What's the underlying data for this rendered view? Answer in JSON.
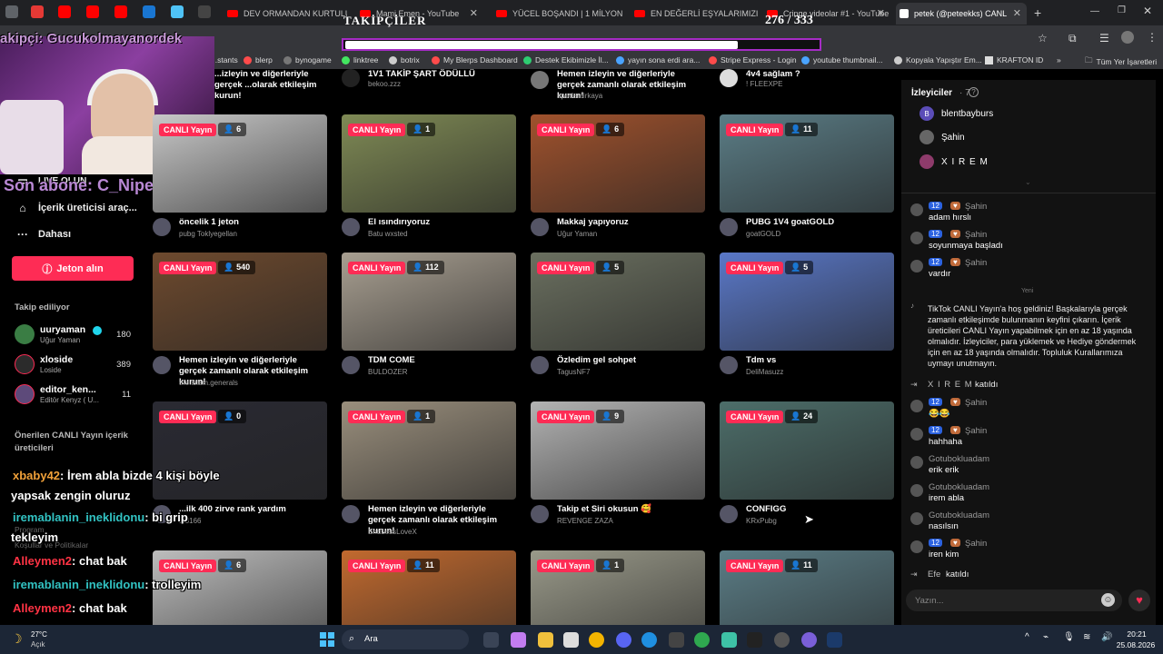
{
  "browser": {
    "tabs": [
      {
        "label": "DEV ORMANDAN KURTULUŞ"
      },
      {
        "label": "Mami Emen - YouTube"
      },
      {
        "label": "YÜCEL BOŞANDI | 1 MİLYON"
      },
      {
        "label": "EN DEĞERLİ EŞYALARIMIZI K"
      },
      {
        "label": "Cringe videolar #1 - YouTube"
      },
      {
        "label": "petek (@peteekks) CANL"
      }
    ],
    "new_tab": "+",
    "bookmarks": [
      "...stants",
      "blerp",
      "bynogame",
      "linktree",
      "botrix",
      "My Blerps Dashboard",
      "Destek Ekibimizle İl...",
      "yayın sona erdi ara...",
      "Stripe Express - Login",
      "youtube thumbnail...",
      "Kopyala Yapıştır Em...",
      "KRAFTON ID",
      "»",
      "Tüm Yer İşaretleri"
    ]
  },
  "overlay": {
    "followers_title": "TAKİPÇİLER",
    "followers_count": "276 / 333",
    "follower_name": "akipçi: Gucukolmayanordek",
    "last_sub": "Son abone: C_Niper",
    "chat": [
      {
        "user": "xbaby42",
        "text": ": İrem abla bizde 4 kişi böyle",
        "cont": "yapsak zengin oluruz",
        "color": "#f2a23a"
      },
      {
        "user": "iremablanin_ineklidonu",
        "text": ": bi grip",
        "cont": "tekleyim",
        "color": "#32c3c3"
      },
      {
        "user": "Alleymen2",
        "text": ": chat bak",
        "cont": "",
        "color": "#ff3344"
      },
      {
        "user": "iremablanin_ineklidonu",
        "text": ": trolleyim",
        "cont": "",
        "color": "#32c3c3"
      },
      {
        "user": "Alleymen2",
        "text": ": chat bak",
        "cont": "",
        "color": "#ff3344"
      }
    ]
  },
  "sidebar": {
    "go_live": "LIVE OLUN",
    "creator_tools": "İçerik üreticisi araç...",
    "more": "Dahası",
    "coins_button": "Jeton alın",
    "following_header": "Takip ediliyor",
    "following": [
      {
        "name": "uuryaman",
        "sub": "Uğur Yaman",
        "count": "180"
      },
      {
        "name": "xloside",
        "sub": "Loside",
        "count": "389"
      },
      {
        "name": "editor_ken...",
        "sub": "Editör Kenyz ( U...",
        "count": "11"
      }
    ],
    "suggested_header": "Önerilen CANLI Yayın içerik üreticileri",
    "footer_bits": [
      "Program",
      "Koşullar ve Politikalar"
    ]
  },
  "live_label": "CANLI Yayın",
  "top_row": [
    {
      "title": "1V1 TAKİP ŞART ÖDÜLLÜ",
      "sub": "bekoo.zzz"
    },
    {
      "title": "Hemen izleyin ve diğerleriyle gerçek zamanlı olarak etkileşim kurun!",
      "sub": "apodemirkaya"
    },
    {
      "title": "4v4 sağlam ?",
      "sub": "! FLEEXPE"
    }
  ],
  "top_row_left": "...izleyin ve diğerleriyle gerçek ...olarak etkileşim kurun!",
  "cards": [
    {
      "count": "6",
      "title": "öncelik 1 jeton",
      "sub": "pubg Toklyegellan",
      "color": "#c8c8c8"
    },
    {
      "count": "1",
      "title": "El ısındırıyoruz",
      "sub": "Batu wxsted",
      "color": "#7f8a55"
    },
    {
      "count": "6",
      "title": "Makkaj yapıyoruz",
      "sub": "Uğur Yaman",
      "color": "#a0522d"
    },
    {
      "count": "11",
      "title": "PUBG 1V4 goatGOLD",
      "sub": "goatGOLD",
      "color": "#5b7d86"
    },
    {
      "count": "540",
      "title": "Hemen izleyin ve diğerleriyle gerçek zamanlı olarak etkileşim kurun!",
      "sub": "the.islam.generals",
      "color": "#6e4a2e"
    },
    {
      "count": "112",
      "title": "TDM COME",
      "sub": "BULDOZER",
      "color": "#a89f91"
    },
    {
      "count": "5",
      "title": "Özledim gel sohpet",
      "sub": "TagusNF7",
      "color": "#6b7060"
    },
    {
      "count": "5",
      "title": "Tdm vs",
      "sub": "DeliMasuzz",
      "color": "#5a78c8"
    },
    {
      "count": "0",
      "title": "...ilk 400 zirve rank yardım",
      "sub": "...8166",
      "color": "#2a2a33"
    },
    {
      "count": "1",
      "title": "Hemen izleyin ve diğerleriyle gerçek zamanlı olarak etkileşim kurun!",
      "sub": "EndLessLoveX",
      "color": "#9a8f7d"
    },
    {
      "count": "9",
      "title": "Takip et Siri okusun 🥰",
      "sub": "REVENGE ZAZA",
      "color": "#b3b3b3"
    },
    {
      "count": "24",
      "title": "CONFIGG",
      "sub": "KRxPubg",
      "color": "#4d6e6a"
    },
    {
      "count": "6",
      "title": "",
      "sub": "",
      "color": "#bdbdbd"
    },
    {
      "count": "11",
      "title": "",
      "sub": "",
      "color": "#c26a2f"
    },
    {
      "count": "1",
      "title": "",
      "sub": "",
      "color": "#9a9a8a"
    },
    {
      "count": "11",
      "title": "",
      "sub": "",
      "color": "#5b7d86"
    }
  ],
  "panel": {
    "viewers_header": "İzleyiciler",
    "viewers_count": "· 7",
    "viewers": [
      "blentbayburs",
      "Şahin",
      "X I R E M"
    ],
    "messages": [
      {
        "user": "Şahin",
        "text": "adam hırslı",
        "lvl": "12"
      },
      {
        "user": "Şahin",
        "text": "soyunmaya başladı",
        "lvl": "12"
      },
      {
        "user": "Şahin",
        "text": "vardır",
        "lvl": "12"
      }
    ],
    "new_label": "Yeni",
    "welcome": "TikTok CANLI Yayın'a hoş geldiniz! Başkalarıyla gerçek zamanlı etkileşimde bulunmanın keyfini çıkarın. İçerik üreticileri CANLI Yayın yapabilmek için en az 18 yaşında olmalıdır. İzleyiciler, para yüklemek ve Hediye göndermek için en az 18 yaşında olmalıdır. Topluluk Kurallarımıza uymayı unutmayın.",
    "joined1_user": "X I R E M",
    "joined_text": "katıldı",
    "messages2": [
      {
        "user": "Şahin",
        "text": "😂😂",
        "lvl": "12"
      },
      {
        "user": "Şahin",
        "text": "hahhaha",
        "lvl": "12"
      },
      {
        "user": "Gotubokluadam",
        "text": "erik erik",
        "lvl": ""
      },
      {
        "user": "Gotubokluadam",
        "text": "irem abla",
        "lvl": ""
      },
      {
        "user": "Gotubokluadam",
        "text": "nasılsın",
        "lvl": ""
      },
      {
        "user": "Şahin",
        "text": "iren kim",
        "lvl": "12"
      }
    ],
    "joined2_user": "Efe",
    "input_placeholder": "Yazın..."
  },
  "taskbar": {
    "weather_temp": "27°C",
    "weather_text": "Açık",
    "search": "Ara",
    "time": "20:21",
    "date": "25.08.2026"
  }
}
